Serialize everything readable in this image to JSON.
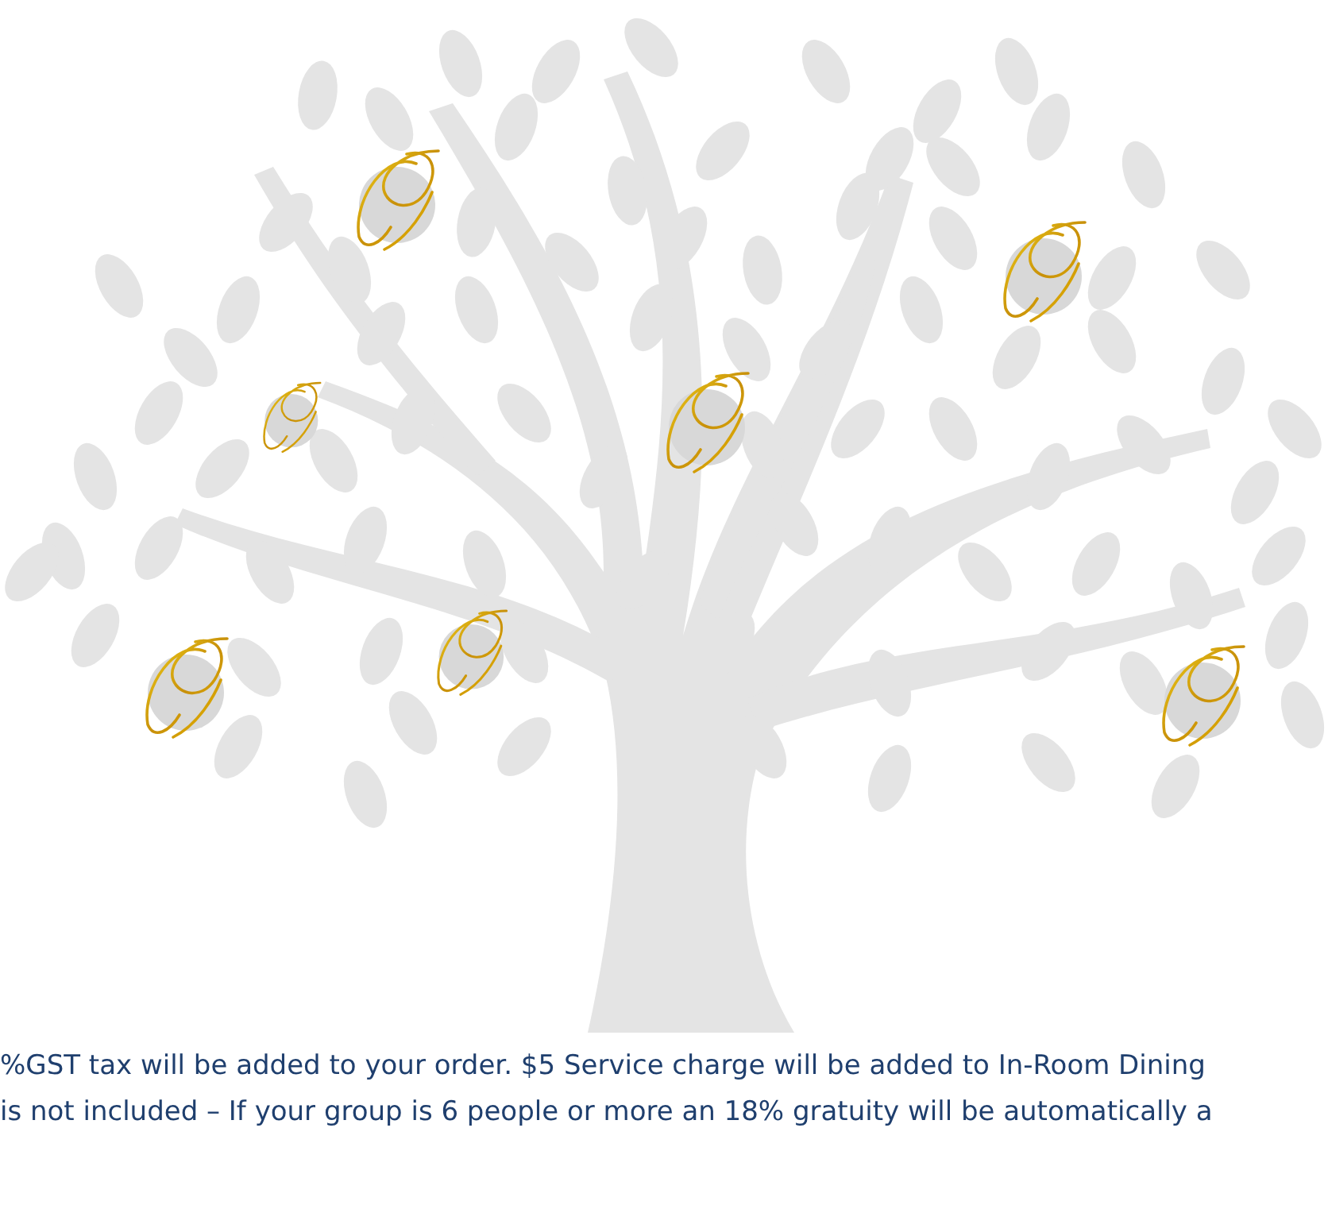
{
  "notice": {
    "lines": [
      "%GST tax will be added to your order. $5 Service charge will be added to In-Room Dining",
      "is not included – If your group is 6 people or more an 18% gratuity will be automatically a"
    ]
  }
}
